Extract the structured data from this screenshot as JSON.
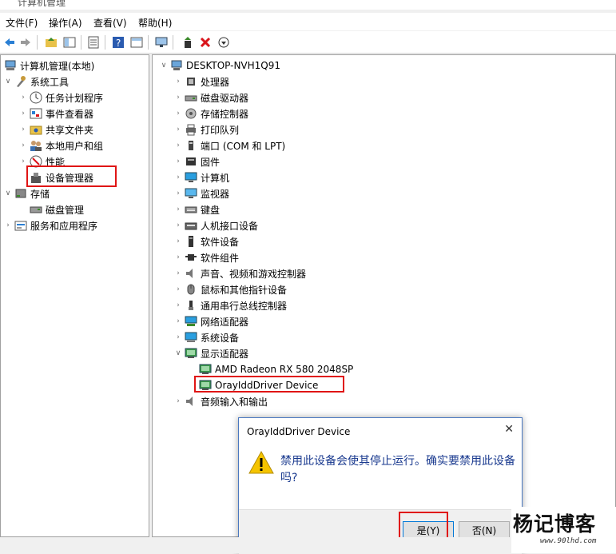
{
  "window": {
    "title": "计算机管理"
  },
  "menu": [
    "文件(F)",
    "操作(A)",
    "查看(V)",
    "帮助(H)"
  ],
  "left_tree": [
    {
      "label": "计算机管理(本地)",
      "indent": 0,
      "arrow": "",
      "icon": "computer-management-icon"
    },
    {
      "label": "系统工具",
      "indent": 1,
      "arrow": "v",
      "icon": "system-tools-icon"
    },
    {
      "label": "任务计划程序",
      "indent": 2,
      "arrow": ">",
      "icon": "clock-icon"
    },
    {
      "label": "事件查看器",
      "indent": 2,
      "arrow": ">",
      "icon": "event-viewer-icon"
    },
    {
      "label": "共享文件夹",
      "indent": 2,
      "arrow": ">",
      "icon": "shared-folder-icon"
    },
    {
      "label": "本地用户和组",
      "indent": 2,
      "arrow": ">",
      "icon": "users-icon"
    },
    {
      "label": "性能",
      "indent": 2,
      "arrow": ">",
      "icon": "performance-icon"
    },
    {
      "label": "设备管理器",
      "indent": 2,
      "arrow": "",
      "icon": "device-manager-icon"
    },
    {
      "label": "存储",
      "indent": 1,
      "arrow": "v",
      "icon": "storage-icon"
    },
    {
      "label": "磁盘管理",
      "indent": 2,
      "arrow": "",
      "icon": "disk-icon"
    },
    {
      "label": "服务和应用程序",
      "indent": 1,
      "arrow": ">",
      "icon": "services-icon"
    }
  ],
  "right_tree": {
    "root": "DESKTOP-NVH1Q91",
    "items": [
      {
        "label": "处理器",
        "arrow": ">",
        "icon": "cpu-icon"
      },
      {
        "label": "磁盘驱动器",
        "arrow": ">",
        "icon": "disk-drive-icon"
      },
      {
        "label": "存储控制器",
        "arrow": ">",
        "icon": "storage-controller-icon"
      },
      {
        "label": "打印队列",
        "arrow": ">",
        "icon": "printer-icon"
      },
      {
        "label": "端口 (COM 和 LPT)",
        "arrow": ">",
        "icon": "port-icon"
      },
      {
        "label": "固件",
        "arrow": ">",
        "icon": "firmware-icon"
      },
      {
        "label": "计算机",
        "arrow": ">",
        "icon": "computer-icon"
      },
      {
        "label": "监视器",
        "arrow": ">",
        "icon": "monitor-icon"
      },
      {
        "label": "键盘",
        "arrow": ">",
        "icon": "keyboard-icon"
      },
      {
        "label": "人机接口设备",
        "arrow": ">",
        "icon": "hid-icon"
      },
      {
        "label": "软件设备",
        "arrow": ">",
        "icon": "software-device-icon"
      },
      {
        "label": "软件组件",
        "arrow": ">",
        "icon": "software-component-icon"
      },
      {
        "label": "声音、视频和游戏控制器",
        "arrow": ">",
        "icon": "sound-icon"
      },
      {
        "label": "鼠标和其他指针设备",
        "arrow": ">",
        "icon": "mouse-icon"
      },
      {
        "label": "通用串行总线控制器",
        "arrow": ">",
        "icon": "usb-icon"
      },
      {
        "label": "网络适配器",
        "arrow": ">",
        "icon": "network-icon"
      },
      {
        "label": "系统设备",
        "arrow": ">",
        "icon": "system-device-icon"
      },
      {
        "label": "显示适配器",
        "arrow": "v",
        "icon": "display-adapter-icon"
      },
      {
        "label": "AMD Radeon RX 580 2048SP",
        "arrow": "",
        "icon": "display-adapter-icon",
        "child": true
      },
      {
        "label": "OrayIddDriver Device",
        "arrow": "",
        "icon": "display-adapter-icon",
        "child": true
      },
      {
        "label": "音频输入和输出",
        "arrow": ">",
        "icon": "audio-icon"
      }
    ]
  },
  "dialog": {
    "title": "OrayIddDriver Device",
    "message": "禁用此设备会使其停止运行。确实要禁用此设备吗?",
    "yes_label": "是(Y)",
    "no_label": "否(N)"
  },
  "watermark": {
    "main": "杨记博客",
    "sub": "www.90lhd.com"
  },
  "colors": {
    "highlight": "#e01515",
    "dialog_text": "#1a3a8f",
    "warning": "#f5c400"
  }
}
